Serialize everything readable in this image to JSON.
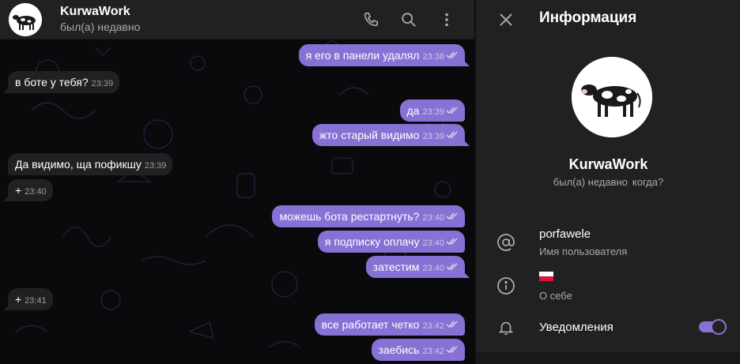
{
  "header": {
    "title": "KurwaWork",
    "status": "был(а) недавно",
    "icons": [
      "phone-icon",
      "search-icon",
      "more-vertical-icon"
    ]
  },
  "messages": [
    {
      "dir": "out",
      "text": "я его в панели удалял",
      "time": "23:38",
      "read": true
    },
    {
      "dir": "in",
      "text": "в боте у тебя?",
      "time": "23:39"
    },
    {
      "dir": "out",
      "text": "да",
      "time": "23:39",
      "read": true
    },
    {
      "dir": "out",
      "text": "жто старый видимо",
      "time": "23:39",
      "read": true
    },
    {
      "dir": "in",
      "text": "Да видимо, ща пофикшу",
      "time": "23:39"
    },
    {
      "dir": "in",
      "text": "+",
      "time": "23:40"
    },
    {
      "dir": "out",
      "text": "можешь бота рестартнуть?",
      "time": "23:40",
      "read": true
    },
    {
      "dir": "out",
      "text": "я подписку оплачу",
      "time": "23:40",
      "read": true
    },
    {
      "dir": "out",
      "text": "затестим",
      "time": "23:40",
      "read": true
    },
    {
      "dir": "in",
      "text": "+",
      "time": "23:41"
    },
    {
      "dir": "out",
      "text": "все работает четко",
      "time": "23:42",
      "read": true
    },
    {
      "dir": "out",
      "text": "заебись",
      "time": "23:42",
      "read": true
    }
  ],
  "info": {
    "title": "Информация",
    "name": "KurwaWork",
    "status": "был(а) недавно",
    "status_when": "когда?",
    "username": "porfawele",
    "username_label": "Имя пользователя",
    "bio_flag": "🇵🇱",
    "bio_label": "О себе",
    "notifications_label": "Уведомления",
    "notifications_on": true
  },
  "colors": {
    "accent": "#8771d4",
    "panel": "#212121",
    "chat_bg": "#0a0a0d",
    "secondary_text": "#aaaaaa"
  }
}
